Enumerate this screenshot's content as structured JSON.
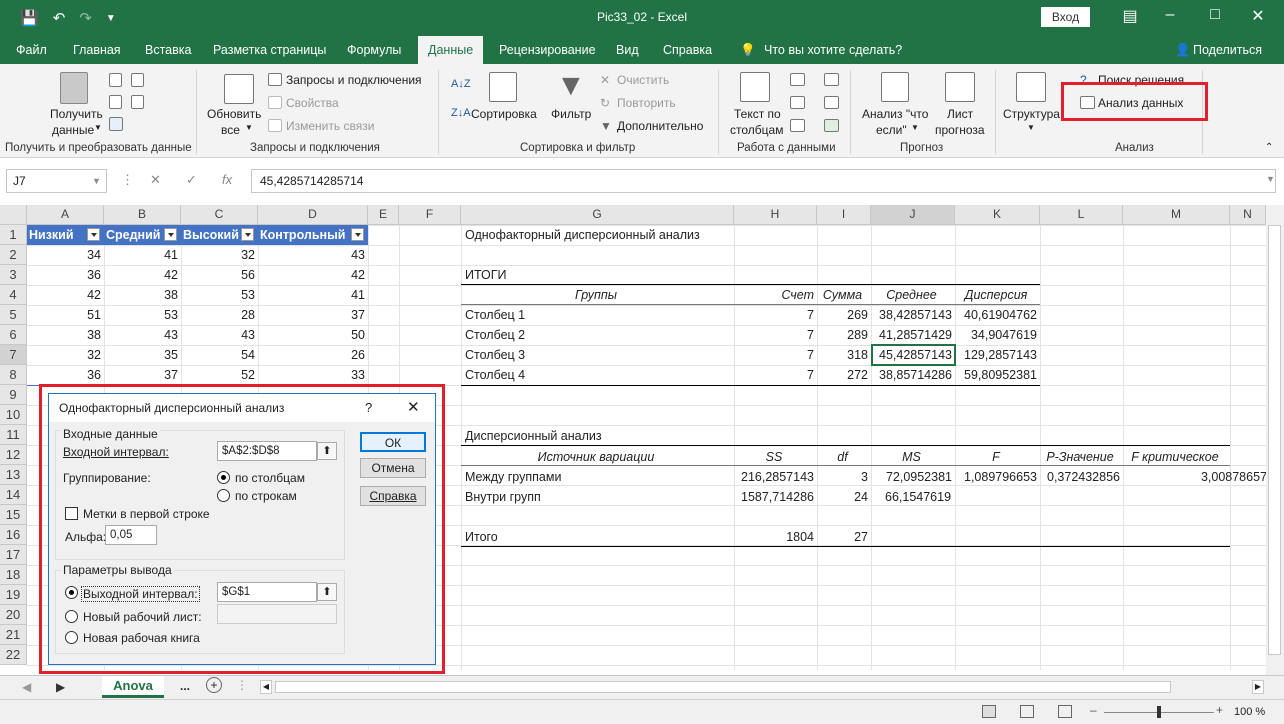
{
  "window": {
    "title": "Pic33_02  -  Excel",
    "login": "Вход"
  },
  "tabs": [
    "Файл",
    "Главная",
    "Вставка",
    "Разметка страницы",
    "Формулы",
    "Данные",
    "Рецензирование",
    "Вид",
    "Справка",
    "Что вы хотите сделать?"
  ],
  "share": "Поделиться",
  "ribbon": {
    "get": {
      "btn1": "Получить",
      "btn2": "данные",
      "label": "Получить и преобразовать данные"
    },
    "queries": {
      "refresh1": "Обновить",
      "refresh2": "все",
      "q1": "Запросы и подключения",
      "q2": "Свойства",
      "q3": "Изменить связи",
      "label": "Запросы и подключения"
    },
    "sort": {
      "sort": "Сортировка",
      "filter": "Фильтр",
      "clear": "Очистить",
      "reapply": "Повторить",
      "advanced": "Дополнительно",
      "label": "Сортировка и фильтр"
    },
    "datatools": {
      "t1": "Текст по",
      "t2": "столбцам",
      "label": "Работа с данными"
    },
    "forecast": {
      "a1": "Анализ \"что",
      "a2": "если\"",
      "s1": "Лист",
      "s2": "прогноза",
      "label": "Прогноз"
    },
    "structure": "Структура",
    "analysis": {
      "solver": "Поиск решения",
      "data": "Анализ данных",
      "label": "Анализ"
    }
  },
  "formula": {
    "name": "J7",
    "value": "45,4285714285714"
  },
  "columns": [
    "A",
    "B",
    "C",
    "D",
    "E",
    "F",
    "G",
    "H",
    "I",
    "J",
    "K",
    "L",
    "M",
    "N"
  ],
  "rows": [
    "1",
    "2",
    "3",
    "4",
    "5",
    "6",
    "7",
    "8",
    "9",
    "10",
    "11",
    "12",
    "13",
    "14",
    "15",
    "16",
    "17",
    "18",
    "19",
    "20",
    "21",
    "22"
  ],
  "table": {
    "headers": [
      "Низкий",
      "Средний",
      "Высокий",
      "Контрольный"
    ],
    "data": [
      [
        "34",
        "41",
        "32",
        "43"
      ],
      [
        "36",
        "42",
        "56",
        "42"
      ],
      [
        "42",
        "38",
        "53",
        "41"
      ],
      [
        "51",
        "53",
        "28",
        "37"
      ],
      [
        "38",
        "43",
        "43",
        "50"
      ],
      [
        "32",
        "35",
        "54",
        "26"
      ],
      [
        "36",
        "37",
        "52",
        "33"
      ]
    ]
  },
  "anova": {
    "title": "Однофакторный дисперсионный анализ",
    "summary": "ИТОГИ",
    "sumHeaders": [
      "Группы",
      "Счет",
      "Сумма",
      "Среднее",
      "Дисперсия"
    ],
    "sumRows": [
      [
        "Столбец 1",
        "7",
        "269",
        "38,42857143",
        "40,61904762"
      ],
      [
        "Столбец 2",
        "7",
        "289",
        "41,28571429",
        "34,9047619"
      ],
      [
        "Столбец 3",
        "7",
        "318",
        "45,42857143",
        "129,2857143"
      ],
      [
        "Столбец 4",
        "7",
        "272",
        "38,85714286",
        "59,80952381"
      ]
    ],
    "anovaTitle": "Дисперсионный анализ",
    "aHeaders": [
      "Источник вариации",
      "SS",
      "df",
      "MS",
      "F",
      "P-Значение",
      "F критическое"
    ],
    "aRows": [
      [
        "Между группами",
        "216,2857143",
        "3",
        "72,0952381",
        "1,089796653",
        "0,372432856",
        "3,00878657"
      ],
      [
        "Внутри групп",
        "1587,714286",
        "24",
        "66,1547619",
        "",
        "",
        ""
      ]
    ],
    "total": [
      "Итого",
      "1804",
      "27"
    ]
  },
  "dialog": {
    "title": "Однофакторный дисперсионный анализ",
    "help": "?",
    "input": "Входные данные",
    "inRange": "Входной интервал:",
    "inValue": "$A$2:$D$8",
    "grouping": "Группирование:",
    "byCols": "по столбцам",
    "byRows": "по строкам",
    "labels": "Метки в первой строке",
    "alpha": "Альфа:",
    "alphaValue": "0,05",
    "output": "Параметры вывода",
    "outRange": "Выходной интервал:",
    "outValue": "$G$1",
    "newSheet": "Новый рабочий лист:",
    "newBook": "Новая рабочая книга",
    "ok": "ОК",
    "cancel": "Отмена",
    "helpBtn": "Справка"
  },
  "sheet": {
    "name": "Anova",
    "more": "...",
    "zoom": "100 %"
  }
}
